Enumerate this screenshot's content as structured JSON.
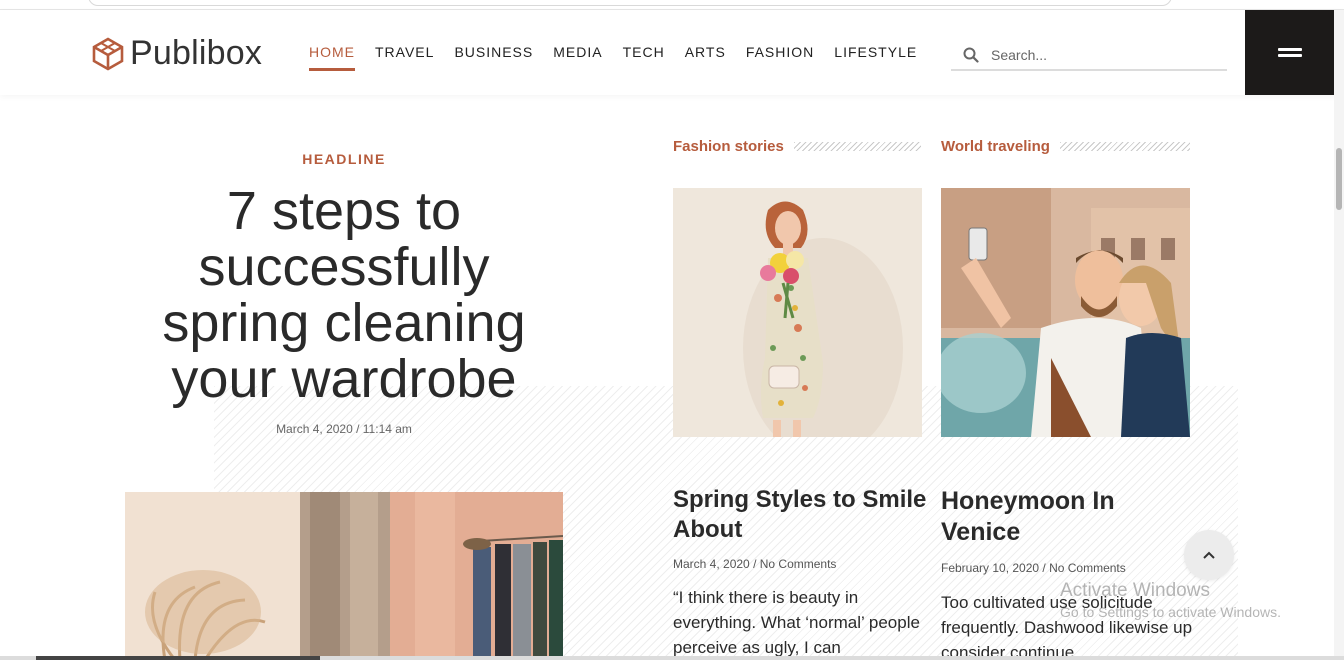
{
  "brand": {
    "name": "Publibox",
    "accent": "#b65c3d",
    "dark": "#1c1a19"
  },
  "nav": {
    "items": [
      {
        "label": "HOME",
        "active": true
      },
      {
        "label": "TRAVEL",
        "active": false
      },
      {
        "label": "BUSINESS",
        "active": false
      },
      {
        "label": "MEDIA",
        "active": false
      },
      {
        "label": "TECH",
        "active": false
      },
      {
        "label": "ARTS",
        "active": false
      },
      {
        "label": "FASHION",
        "active": false
      },
      {
        "label": "LIFESTYLE",
        "active": false
      }
    ]
  },
  "search": {
    "placeholder": "Search...",
    "icon": "search-icon"
  },
  "menu": {
    "icon": "hamburger-icon"
  },
  "headline": {
    "kicker": "HEADLINE",
    "title": "7 steps to successfully spring cleaning your wardrobe",
    "date": "March 4, 2020 / 11:14 am"
  },
  "cards": [
    {
      "category": "Fashion stories",
      "title": "Spring Styles to Smile About",
      "date": "March 4, 2020",
      "comments": "No Comments",
      "excerpt": "“I think there is beauty in everything. What ‘normal’ people perceive as ugly, I can"
    },
    {
      "category": "World traveling",
      "title": "Honeymoon In Venice",
      "date": "February 10, 2020",
      "comments": "No Comments",
      "excerpt": "Too cultivated use solicitude frequently. Dashwood likewise up consider continue"
    }
  ],
  "windows_watermark": {
    "line1": "Activate Windows",
    "line2": "Go to Settings to activate Windows."
  },
  "back_to_top": {
    "icon": "chevron-up-icon"
  }
}
